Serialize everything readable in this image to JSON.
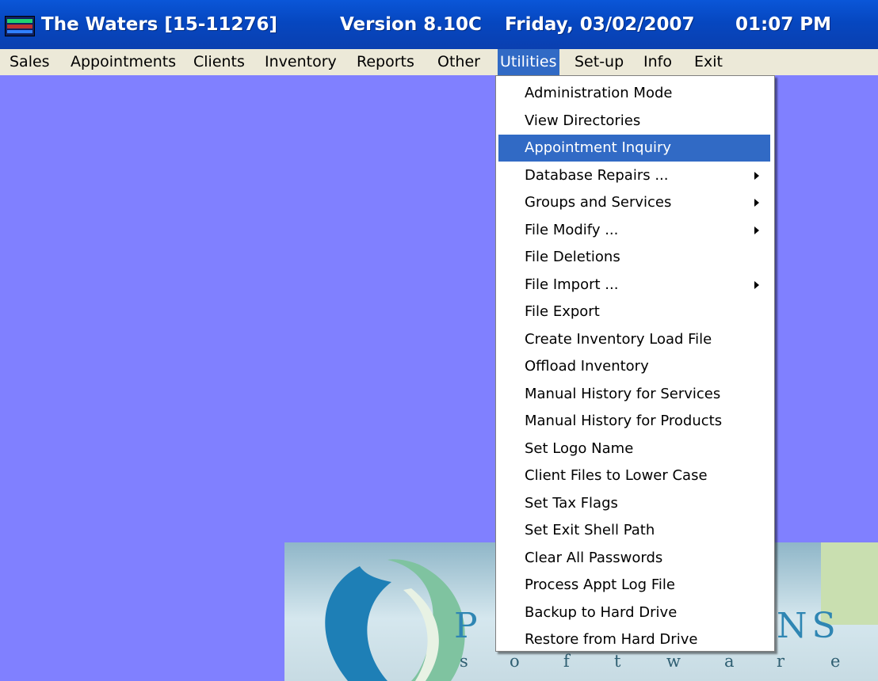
{
  "window": {
    "title": "The Waters [15-11276]",
    "version": "Version 8.10C",
    "date": "Friday, 03/02/2007",
    "time": "01:07 PM"
  },
  "menubar": {
    "items": [
      "Sales",
      "Appointments",
      "Clients",
      "Inventory",
      "Reports",
      "Other",
      "Utilities",
      "Set-up",
      "Info",
      "Exit"
    ],
    "active": "Utilities"
  },
  "utilities_menu": {
    "items": [
      {
        "label": "Administration Mode",
        "submenu": false
      },
      {
        "label": "View Directories",
        "submenu": false
      },
      {
        "label": "Appointment Inquiry",
        "submenu": false,
        "highlighted": true
      },
      {
        "label": "Database Repairs ...",
        "submenu": true
      },
      {
        "label": "Groups and Services",
        "submenu": true
      },
      {
        "label": "File Modify ...",
        "submenu": true
      },
      {
        "label": "File Deletions",
        "submenu": false
      },
      {
        "label": "File Import ...",
        "submenu": true
      },
      {
        "label": "File Export",
        "submenu": false
      },
      {
        "label": "Create Inventory Load File",
        "submenu": false
      },
      {
        "label": "Offload Inventory",
        "submenu": false
      },
      {
        "label": "Manual History for Services",
        "submenu": false
      },
      {
        "label": "Manual History for Products",
        "submenu": false
      },
      {
        "label": "Set Logo Name",
        "submenu": false
      },
      {
        "label": "Client Files to Lower Case",
        "submenu": false
      },
      {
        "label": "Set Tax Flags",
        "submenu": false
      },
      {
        "label": "Set Exit Shell Path",
        "submenu": false
      },
      {
        "label": "Clear All Passwords",
        "submenu": false
      },
      {
        "label": "Process Appt Log File",
        "submenu": false
      },
      {
        "label": "Backup to Hard Drive",
        "submenu": false
      },
      {
        "label": "Restore from Hard Drive",
        "submenu": false
      }
    ]
  },
  "logo": {
    "visible_large": [
      "P",
      "NS"
    ],
    "visible_small": [
      "s",
      "o",
      "f",
      "t",
      "w",
      "a",
      "r",
      "e"
    ]
  },
  "colors": {
    "titlebar": "#0a56d8",
    "menubar": "#ece9d8",
    "desktop": "#8080ff",
    "highlight": "#316ac5"
  }
}
